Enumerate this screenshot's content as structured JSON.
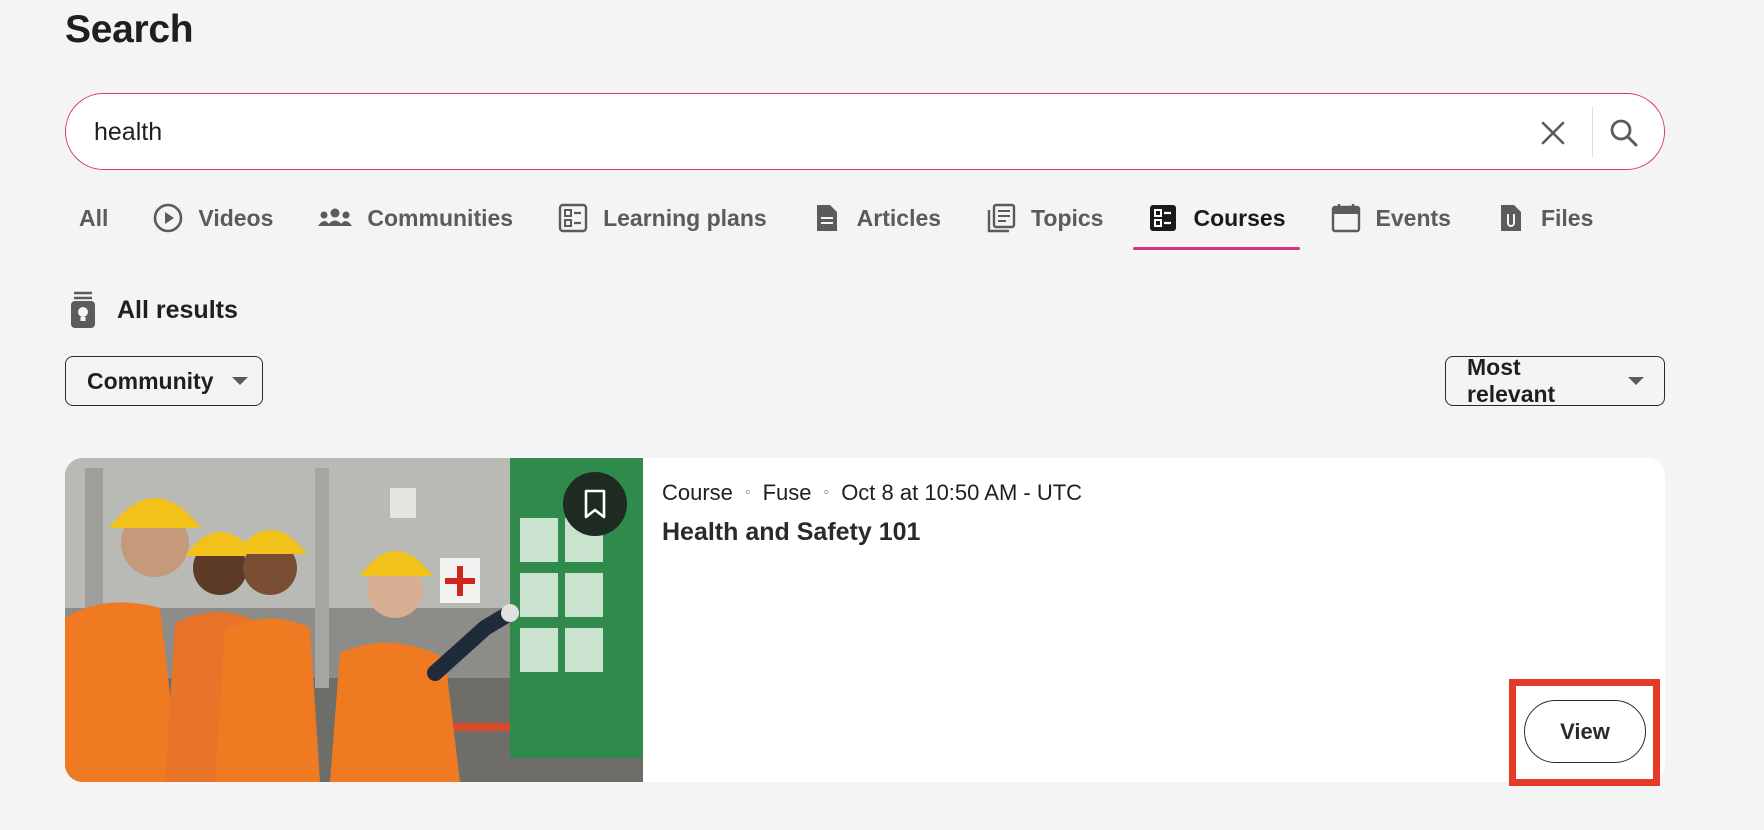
{
  "page": {
    "title": "Search"
  },
  "search": {
    "value": "health",
    "placeholder": ""
  },
  "tabs": [
    {
      "label": "All",
      "icon": "none"
    },
    {
      "label": "Videos",
      "icon": "play-circle-icon"
    },
    {
      "label": "Communities",
      "icon": "people-icon"
    },
    {
      "label": "Learning plans",
      "icon": "checklist-icon"
    },
    {
      "label": "Articles",
      "icon": "document-icon"
    },
    {
      "label": "Topics",
      "icon": "book-icon"
    },
    {
      "label": "Courses",
      "icon": "checklist-filled-icon",
      "active": true
    },
    {
      "label": "Events",
      "icon": "calendar-icon"
    },
    {
      "label": "Files",
      "icon": "file-clip-icon"
    }
  ],
  "results": {
    "heading": "All results"
  },
  "filters": {
    "community_label": "Community",
    "sort_label": "Most relevant"
  },
  "card": {
    "type": "Course",
    "source": "Fuse",
    "date": "Oct 8 at 10:50 AM - UTC",
    "title": "Health and Safety 101",
    "view_label": "View"
  },
  "colors": {
    "accent": "#d63384",
    "highlight": "#e53a2a",
    "background": "#f4f4f4"
  }
}
